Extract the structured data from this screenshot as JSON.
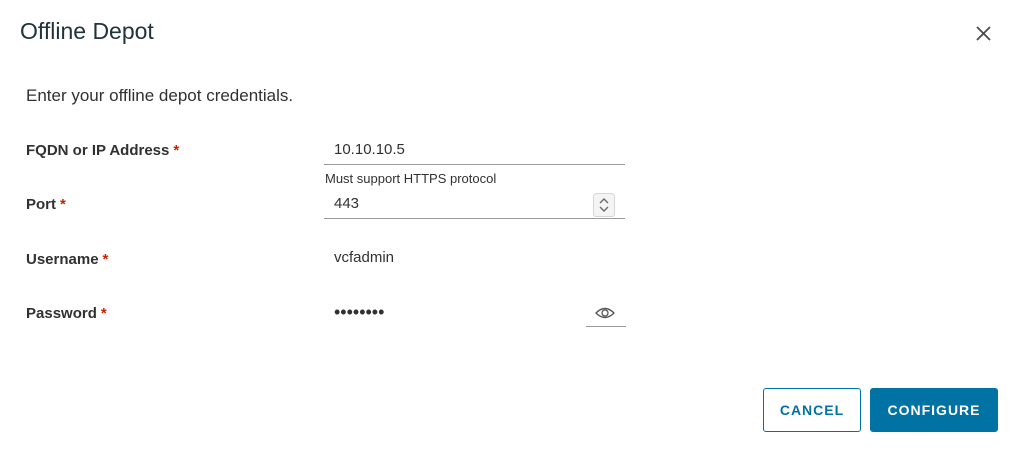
{
  "dialog": {
    "title": "Offline Depot",
    "subtitle": "Enter your offline depot credentials."
  },
  "fields": {
    "fqdn": {
      "label": "FQDN or IP Address",
      "required_mark": "*",
      "value": "10.10.10.5",
      "helper": "Must support HTTPS protocol"
    },
    "port": {
      "label": "Port",
      "required_mark": "*",
      "value": "443"
    },
    "username": {
      "label": "Username",
      "required_mark": "*",
      "value": "vcfadmin"
    },
    "password": {
      "label": "Password",
      "required_mark": "*",
      "masked_value": "••••••••"
    }
  },
  "buttons": {
    "cancel": "CANCEL",
    "configure": "CONFIGURE"
  },
  "colors": {
    "primary": "#0072a3",
    "required": "#c92100"
  },
  "icons": [
    "close-icon",
    "stepper-icon",
    "eye-icon"
  ]
}
